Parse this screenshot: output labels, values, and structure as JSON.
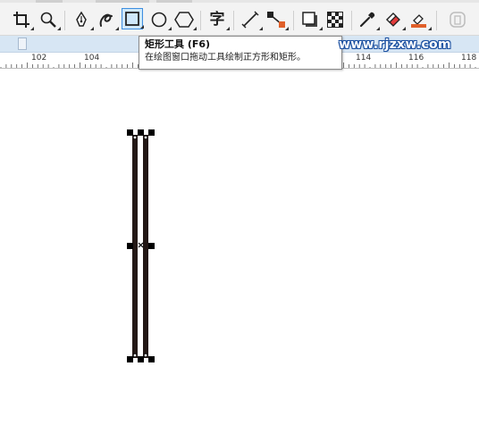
{
  "toolbar": {
    "tools": [
      {
        "name": "crop-tool",
        "icon": "crop-icon"
      },
      {
        "name": "zoom-tool",
        "icon": "magnifier-icon"
      },
      {
        "name": "pen-tool",
        "icon": "pen-nib-icon"
      },
      {
        "name": "artistic-media-tool",
        "icon": "curve-icon"
      },
      {
        "name": "rectangle-tool",
        "icon": "rectangle-icon",
        "active": true
      },
      {
        "name": "ellipse-tool",
        "icon": "ellipse-icon"
      },
      {
        "name": "polygon-tool",
        "icon": "hexagon-icon"
      },
      {
        "name": "text-tool",
        "icon": "text-glyph-icon",
        "label": "字"
      },
      {
        "name": "parallel-dimension-tool",
        "icon": "dimension-line-icon"
      },
      {
        "name": "connector-tool",
        "icon": "connector-icon"
      },
      {
        "name": "drop-shadow-tool",
        "icon": "drop-shadow-icon"
      },
      {
        "name": "transparency-tool",
        "icon": "checkerboard-icon"
      },
      {
        "name": "eyedropper-tool",
        "icon": "eyedropper-icon"
      },
      {
        "name": "interactive-fill-tool",
        "icon": "paint-bucket-icon"
      },
      {
        "name": "smart-fill-tool",
        "icon": "smart-fill-icon"
      },
      {
        "name": "options-tool",
        "icon": "options-icon"
      }
    ]
  },
  "ruler": {
    "labels": [
      "102",
      "104",
      "114",
      "116",
      "118"
    ]
  },
  "tooltip": {
    "title": "矩形工具 (F6)",
    "description": "在绘图窗口拖动工具绘制正方形和矩形。"
  },
  "watermark": "www.rjzxw.com",
  "colors": {
    "active_tool_bg": "#cfe8fb",
    "active_tool_border": "#3d8ee0",
    "property_bar": "#d7e6f4",
    "shape_fill": "#231815",
    "watermark_outline": "#1a4fa0"
  }
}
